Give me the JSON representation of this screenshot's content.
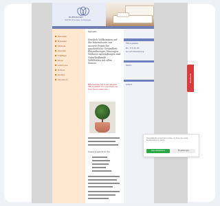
{
  "header": {
    "logo_text": "RUHEPUNKT",
    "logo_subtitle": "Wohlfühl-Therapien & Massagen"
  },
  "sidebar": {
    "items": [
      {
        "label": "Startseite"
      },
      {
        "label": "Massagen"
      },
      {
        "label": "Wellness"
      },
      {
        "label": "Kosmetik"
      },
      {
        "label": "Fußpflege"
      },
      {
        "label": "Preise"
      },
      {
        "label": "Gutscheine"
      },
      {
        "label": "Termine"
      },
      {
        "label": "Kontakt"
      },
      {
        "label": "Impressum"
      }
    ]
  },
  "content": {
    "breadcrumb": "Startseite",
    "heading": "Herzlich Willkommen auf der Internetseite von unserer Praxis für ganzheitliche Gesundheit, Physiotherapie, Massagen, Wellness-Anwendungen und Naturheilkunde – Wohlfühlen mit allen Sinnen.",
    "red_note": "Bitte beachten Sie unsere aktuellen Öffnungszeiten und vereinbaren Sie Ihren Termin telefonisch.",
    "section_label": "Unsere Angebote für Sie:"
  },
  "right_column": {
    "title": "Öffnungszeiten",
    "lines": [
      "Mo – Fr 8–19 Uhr",
      "Sa nach Vereinbarung",
      "Telefon",
      "Anfahrt"
    ]
  },
  "feedback_tab": {
    "label": "Feedback"
  },
  "cookie_banner": {
    "text": "Diese Website verwendet Cookies, um Ihnen das beste Nutzererlebnis zu bieten.",
    "accept_label": "Alles akzeptieren",
    "settings_label": "Einstellungen"
  },
  "colors": {
    "sidebar_bg": "#ffe8cf",
    "nav_strip": "#6f7fb3",
    "accept_green": "#27a844",
    "feedback_red": "#d93b3b"
  }
}
